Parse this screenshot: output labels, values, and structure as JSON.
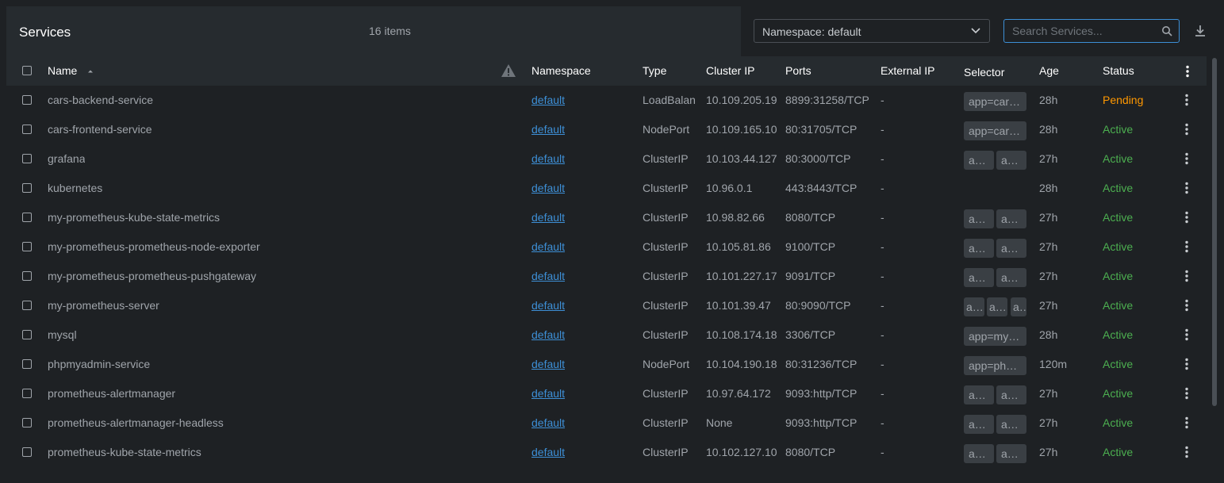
{
  "header": {
    "title": "Services",
    "count": "16 items",
    "namespace_select": "Namespace: default",
    "search_placeholder": "Search Services..."
  },
  "columns": {
    "name": "Name",
    "namespace": "Namespace",
    "type": "Type",
    "cluster_ip": "Cluster IP",
    "ports": "Ports",
    "external_ip": "External IP",
    "selector": "Selector",
    "age": "Age",
    "status": "Status"
  },
  "status_colors": {
    "Active": "#4caf50",
    "Pending": "#ff9800"
  },
  "rows": [
    {
      "name": "cars-backend-service",
      "namespace": "default",
      "type": "LoadBalan",
      "cluster_ip": "10.109.205.19",
      "ports": "8899:31258/TCP",
      "external_ip": "-",
      "selectors": [
        "app=car…"
      ],
      "age": "28h",
      "status": "Pending"
    },
    {
      "name": "cars-frontend-service",
      "namespace": "default",
      "type": "NodePort",
      "cluster_ip": "10.109.165.10",
      "ports": "80:31705/TCP",
      "external_ip": "-",
      "selectors": [
        "app=car…"
      ],
      "age": "28h",
      "status": "Active"
    },
    {
      "name": "grafana",
      "namespace": "default",
      "type": "ClusterIP",
      "cluster_ip": "10.103.44.127",
      "ports": "80:3000/TCP",
      "external_ip": "-",
      "selectors": [
        "ap…",
        "a…"
      ],
      "age": "27h",
      "status": "Active"
    },
    {
      "name": "kubernetes",
      "namespace": "default",
      "type": "ClusterIP",
      "cluster_ip": "10.96.0.1",
      "ports": "443:8443/TCP",
      "external_ip": "-",
      "selectors": [],
      "age": "28h",
      "status": "Active"
    },
    {
      "name": "my-prometheus-kube-state-metrics",
      "namespace": "default",
      "type": "ClusterIP",
      "cluster_ip": "10.98.82.66",
      "ports": "8080/TCP",
      "external_ip": "-",
      "selectors": [
        "a…",
        "a…"
      ],
      "age": "27h",
      "status": "Active"
    },
    {
      "name": "my-prometheus-prometheus-node-exporter",
      "namespace": "default",
      "type": "ClusterIP",
      "cluster_ip": "10.105.81.86",
      "ports": "9100/TCP",
      "external_ip": "-",
      "selectors": [
        "a…",
        "ap…"
      ],
      "age": "27h",
      "status": "Active"
    },
    {
      "name": "my-prometheus-prometheus-pushgateway",
      "namespace": "default",
      "type": "ClusterIP",
      "cluster_ip": "10.101.227.17",
      "ports": "9091/TCP",
      "external_ip": "-",
      "selectors": [
        "a…",
        "ap…"
      ],
      "age": "27h",
      "status": "Active"
    },
    {
      "name": "my-prometheus-server",
      "namespace": "default",
      "type": "ClusterIP",
      "cluster_ip": "10.101.39.47",
      "ports": "80:9090/TCP",
      "external_ip": "-",
      "selectors": [
        "a…",
        "a…",
        "a…"
      ],
      "age": "27h",
      "status": "Active"
    },
    {
      "name": "mysql",
      "namespace": "default",
      "type": "ClusterIP",
      "cluster_ip": "10.108.174.18",
      "ports": "3306/TCP",
      "external_ip": "-",
      "selectors": [
        "app=my…"
      ],
      "age": "28h",
      "status": "Active"
    },
    {
      "name": "phpmyadmin-service",
      "namespace": "default",
      "type": "NodePort",
      "cluster_ip": "10.104.190.18",
      "ports": "80:31236/TCP",
      "external_ip": "-",
      "selectors": [
        "app=ph…"
      ],
      "age": "120m",
      "status": "Active"
    },
    {
      "name": "prometheus-alertmanager",
      "namespace": "default",
      "type": "ClusterIP",
      "cluster_ip": "10.97.64.172",
      "ports": "9093:http/TCP",
      "external_ip": "-",
      "selectors": [
        "ap…",
        "a…"
      ],
      "age": "27h",
      "status": "Active"
    },
    {
      "name": "prometheus-alertmanager-headless",
      "namespace": "default",
      "type": "ClusterIP",
      "cluster_ip": "None",
      "ports": "9093:http/TCP",
      "external_ip": "-",
      "selectors": [
        "ap…",
        "a…"
      ],
      "age": "27h",
      "status": "Active"
    },
    {
      "name": "prometheus-kube-state-metrics",
      "namespace": "default",
      "type": "ClusterIP",
      "cluster_ip": "10.102.127.10",
      "ports": "8080/TCP",
      "external_ip": "-",
      "selectors": [
        "a…",
        "ap…"
      ],
      "age": "27h",
      "status": "Active"
    }
  ]
}
